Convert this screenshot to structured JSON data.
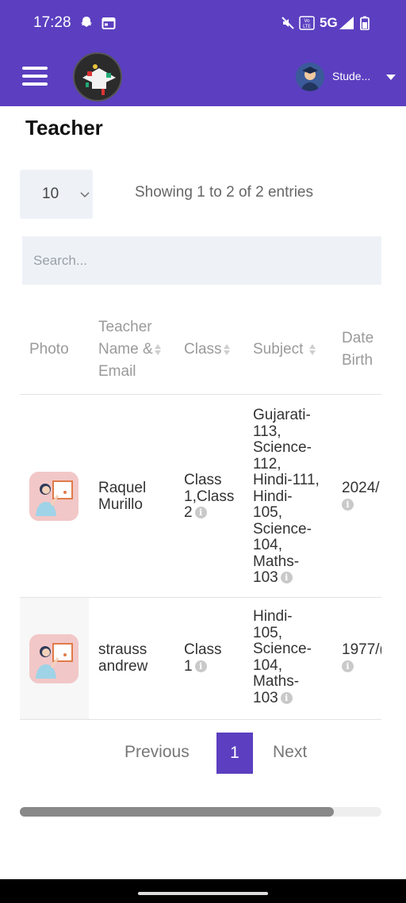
{
  "status_bar": {
    "time": "17:28",
    "network": "5G"
  },
  "app_bar": {
    "user_name": "Stude..."
  },
  "page": {
    "title": "Teacher"
  },
  "controls": {
    "page_length": "10",
    "info": "Showing 1 to 2 of 2 entries",
    "search_placeholder": "Search..."
  },
  "table": {
    "headers": {
      "photo": "Photo",
      "name_line1": "Teacher",
      "name_line2": "Name &",
      "name_line3": "Email",
      "class": "Class",
      "subject": "Subject",
      "dob_line1": "Date",
      "dob_line2": "Birth"
    },
    "rows": [
      {
        "name_line1": "Raquel",
        "name_line2": "Murillo",
        "class_line1": "Class",
        "class_line2": "1,Class",
        "class_line3": "2",
        "subject_lines": [
          "Gujarati-",
          "113,",
          "Science-",
          "112,",
          "Hindi-111,",
          "Hindi-",
          "105,",
          "Science-",
          "104,",
          "Maths-",
          "103"
        ],
        "dob": "2024/"
      },
      {
        "name_line1": "strauss",
        "name_line2": "andrew",
        "class_line1": "Class",
        "class_line2": "1",
        "subject_lines": [
          "Hindi-",
          "105,",
          "Science-",
          "104,",
          "Maths-",
          "103"
        ],
        "dob": "1977/("
      }
    ]
  },
  "pagination": {
    "previous": "Previous",
    "current": "1",
    "next": "Next"
  },
  "colors": {
    "primary": "#5b3fc0",
    "input_bg": "#eef2f7",
    "header_text": "#9a9a9a"
  }
}
